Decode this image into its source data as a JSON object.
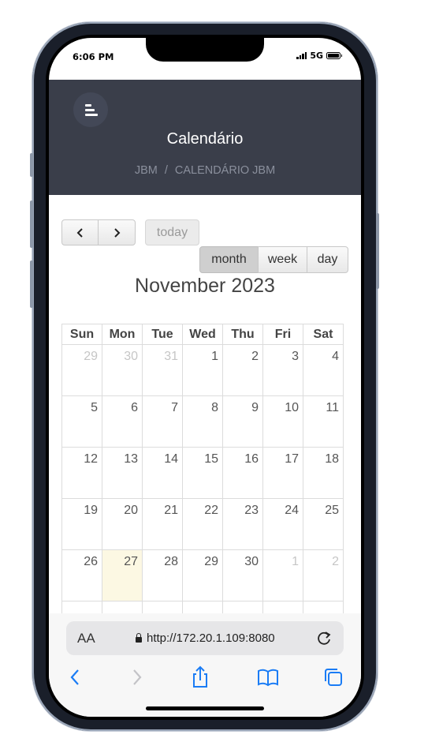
{
  "status": {
    "time": "6:06 PM",
    "network": "5G"
  },
  "header": {
    "title": "Calendário",
    "breadcrumb": [
      "JBM",
      "CALENDÁRIO JBM"
    ]
  },
  "toolbar": {
    "prev_icon": "chevron-left-icon",
    "next_icon": "chevron-right-icon",
    "today_label": "today",
    "views": [
      "month",
      "week",
      "day"
    ],
    "active_view": "month"
  },
  "calendar": {
    "title": "November 2023",
    "weekdays": [
      "Sun",
      "Mon",
      "Tue",
      "Wed",
      "Thu",
      "Fri",
      "Sat"
    ],
    "weeks": [
      [
        "29",
        "30",
        "31",
        "1",
        "2",
        "3",
        "4"
      ],
      [
        "5",
        "6",
        "7",
        "8",
        "9",
        "10",
        "11"
      ],
      [
        "12",
        "13",
        "14",
        "15",
        "16",
        "17",
        "18"
      ],
      [
        "19",
        "20",
        "21",
        "22",
        "23",
        "24",
        "25"
      ],
      [
        "26",
        "27",
        "28",
        "29",
        "30",
        "1",
        "2"
      ]
    ],
    "today": "27",
    "today_color": "#fcf8e3"
  },
  "browser": {
    "text_size_label": "AA",
    "url": "http://172.20.1.109:8080",
    "nav_icons": [
      "back-icon",
      "forward-icon",
      "share-icon",
      "bookmarks-icon",
      "tabs-icon"
    ],
    "accent": "#1a7cf5"
  },
  "colors": {
    "header_bg": "#3a3e4a"
  }
}
